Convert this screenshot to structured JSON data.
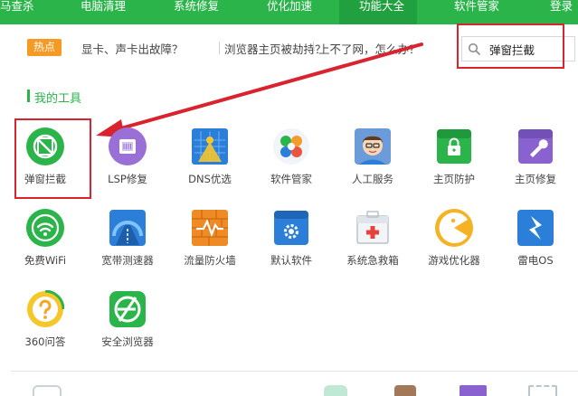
{
  "nav": {
    "items": [
      {
        "label": "马查杀"
      },
      {
        "label": "电脑清理"
      },
      {
        "label": "系统修复"
      },
      {
        "label": "优化加速"
      },
      {
        "label": "功能大全",
        "active": true
      },
      {
        "label": "软件管家"
      },
      {
        "label": "登录"
      }
    ],
    "bg_color": "#2ab44a",
    "active_color": "#21a03f"
  },
  "hot": {
    "badge": "热点",
    "links": [
      "显卡、声卡出故障？",
      "浏览器主页被劫持？",
      "上不了网，怎么办？"
    ]
  },
  "search": {
    "value": "弹窗拦截",
    "icon": "search-icon"
  },
  "section": {
    "title": "我的工具"
  },
  "tools": [
    {
      "label": "弹窗拦截",
      "icon": "popup-block-icon",
      "highlighted": true
    },
    {
      "label": "LSP修复",
      "icon": "lsp-repair-icon"
    },
    {
      "label": "DNS优选",
      "icon": "dns-icon"
    },
    {
      "label": "软件管家",
      "icon": "software-manager-icon"
    },
    {
      "label": "人工服务",
      "icon": "human-service-icon"
    },
    {
      "label": "主页防护",
      "icon": "homepage-protect-icon"
    },
    {
      "label": "主页修复",
      "icon": "homepage-repair-icon"
    },
    {
      "label": "免费WiFi",
      "icon": "wifi-icon"
    },
    {
      "label": "宽带测速器",
      "icon": "speedometer-icon"
    },
    {
      "label": "流量防火墙",
      "icon": "firewall-icon"
    },
    {
      "label": "默认软件",
      "icon": "default-software-icon"
    },
    {
      "label": "系统急救箱",
      "icon": "first-aid-icon"
    },
    {
      "label": "游戏优化器",
      "icon": "game-optimizer-icon"
    },
    {
      "label": "雷电OS",
      "icon": "thunder-os-icon"
    },
    {
      "label": "360问答",
      "icon": "question-icon"
    },
    {
      "label": "安全浏览器",
      "icon": "browser-icon"
    }
  ],
  "accent": "#2ab44a",
  "annotation_color": "#d9232e"
}
